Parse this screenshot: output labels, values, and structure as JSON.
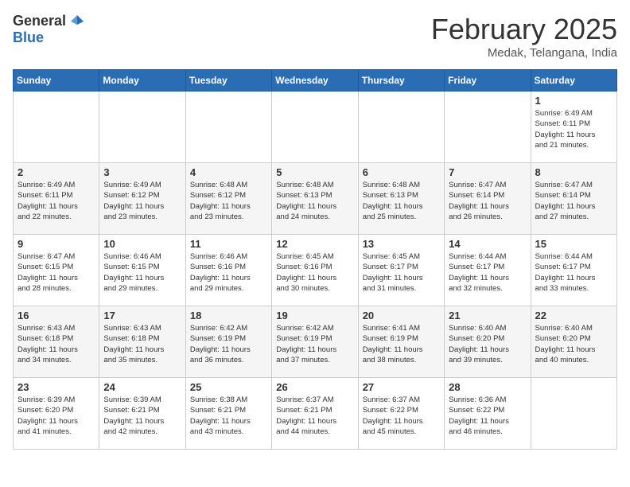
{
  "logo": {
    "general": "General",
    "blue": "Blue"
  },
  "title": "February 2025",
  "location": "Medak, Telangana, India",
  "weekdays": [
    "Sunday",
    "Monday",
    "Tuesday",
    "Wednesday",
    "Thursday",
    "Friday",
    "Saturday"
  ],
  "weeks": [
    [
      {
        "day": "",
        "info": ""
      },
      {
        "day": "",
        "info": ""
      },
      {
        "day": "",
        "info": ""
      },
      {
        "day": "",
        "info": ""
      },
      {
        "day": "",
        "info": ""
      },
      {
        "day": "",
        "info": ""
      },
      {
        "day": "1",
        "info": "Sunrise: 6:49 AM\nSunset: 6:11 PM\nDaylight: 11 hours\nand 21 minutes."
      }
    ],
    [
      {
        "day": "2",
        "info": "Sunrise: 6:49 AM\nSunset: 6:11 PM\nDaylight: 11 hours\nand 22 minutes."
      },
      {
        "day": "3",
        "info": "Sunrise: 6:49 AM\nSunset: 6:12 PM\nDaylight: 11 hours\nand 23 minutes."
      },
      {
        "day": "4",
        "info": "Sunrise: 6:48 AM\nSunset: 6:12 PM\nDaylight: 11 hours\nand 23 minutes."
      },
      {
        "day": "5",
        "info": "Sunrise: 6:48 AM\nSunset: 6:13 PM\nDaylight: 11 hours\nand 24 minutes."
      },
      {
        "day": "6",
        "info": "Sunrise: 6:48 AM\nSunset: 6:13 PM\nDaylight: 11 hours\nand 25 minutes."
      },
      {
        "day": "7",
        "info": "Sunrise: 6:47 AM\nSunset: 6:14 PM\nDaylight: 11 hours\nand 26 minutes."
      },
      {
        "day": "8",
        "info": "Sunrise: 6:47 AM\nSunset: 6:14 PM\nDaylight: 11 hours\nand 27 minutes."
      }
    ],
    [
      {
        "day": "9",
        "info": "Sunrise: 6:47 AM\nSunset: 6:15 PM\nDaylight: 11 hours\nand 28 minutes."
      },
      {
        "day": "10",
        "info": "Sunrise: 6:46 AM\nSunset: 6:15 PM\nDaylight: 11 hours\nand 29 minutes."
      },
      {
        "day": "11",
        "info": "Sunrise: 6:46 AM\nSunset: 6:16 PM\nDaylight: 11 hours\nand 29 minutes."
      },
      {
        "day": "12",
        "info": "Sunrise: 6:45 AM\nSunset: 6:16 PM\nDaylight: 11 hours\nand 30 minutes."
      },
      {
        "day": "13",
        "info": "Sunrise: 6:45 AM\nSunset: 6:17 PM\nDaylight: 11 hours\nand 31 minutes."
      },
      {
        "day": "14",
        "info": "Sunrise: 6:44 AM\nSunset: 6:17 PM\nDaylight: 11 hours\nand 32 minutes."
      },
      {
        "day": "15",
        "info": "Sunrise: 6:44 AM\nSunset: 6:17 PM\nDaylight: 11 hours\nand 33 minutes."
      }
    ],
    [
      {
        "day": "16",
        "info": "Sunrise: 6:43 AM\nSunset: 6:18 PM\nDaylight: 11 hours\nand 34 minutes."
      },
      {
        "day": "17",
        "info": "Sunrise: 6:43 AM\nSunset: 6:18 PM\nDaylight: 11 hours\nand 35 minutes."
      },
      {
        "day": "18",
        "info": "Sunrise: 6:42 AM\nSunset: 6:19 PM\nDaylight: 11 hours\nand 36 minutes."
      },
      {
        "day": "19",
        "info": "Sunrise: 6:42 AM\nSunset: 6:19 PM\nDaylight: 11 hours\nand 37 minutes."
      },
      {
        "day": "20",
        "info": "Sunrise: 6:41 AM\nSunset: 6:19 PM\nDaylight: 11 hours\nand 38 minutes."
      },
      {
        "day": "21",
        "info": "Sunrise: 6:40 AM\nSunset: 6:20 PM\nDaylight: 11 hours\nand 39 minutes."
      },
      {
        "day": "22",
        "info": "Sunrise: 6:40 AM\nSunset: 6:20 PM\nDaylight: 11 hours\nand 40 minutes."
      }
    ],
    [
      {
        "day": "23",
        "info": "Sunrise: 6:39 AM\nSunset: 6:20 PM\nDaylight: 11 hours\nand 41 minutes."
      },
      {
        "day": "24",
        "info": "Sunrise: 6:39 AM\nSunset: 6:21 PM\nDaylight: 11 hours\nand 42 minutes."
      },
      {
        "day": "25",
        "info": "Sunrise: 6:38 AM\nSunset: 6:21 PM\nDaylight: 11 hours\nand 43 minutes."
      },
      {
        "day": "26",
        "info": "Sunrise: 6:37 AM\nSunset: 6:21 PM\nDaylight: 11 hours\nand 44 minutes."
      },
      {
        "day": "27",
        "info": "Sunrise: 6:37 AM\nSunset: 6:22 PM\nDaylight: 11 hours\nand 45 minutes."
      },
      {
        "day": "28",
        "info": "Sunrise: 6:36 AM\nSunset: 6:22 PM\nDaylight: 11 hours\nand 46 minutes."
      },
      {
        "day": "",
        "info": ""
      }
    ]
  ]
}
